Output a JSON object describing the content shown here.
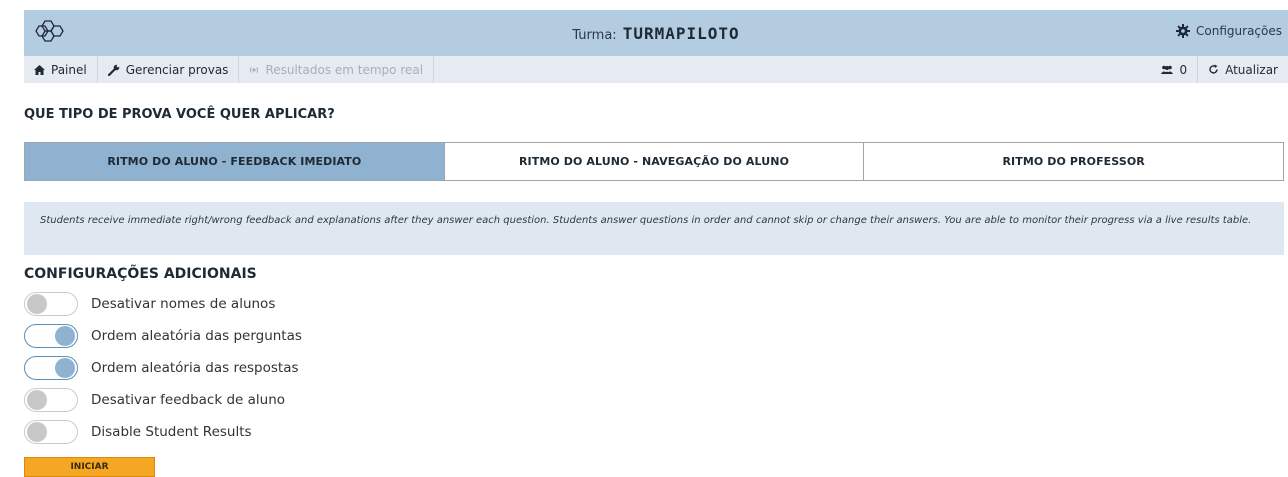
{
  "header": {
    "class_label": "Turma:",
    "class_code": "TURMAPILOTO",
    "settings_label": "Configurações"
  },
  "nav": {
    "items": [
      {
        "label": "Painel",
        "icon": "home-icon"
      },
      {
        "label": "Gerenciar provas",
        "icon": "wrench-icon"
      },
      {
        "label": "Resultados em tempo real",
        "icon": "live-results-icon"
      }
    ],
    "students_count": "0",
    "refresh_label": "Atualizar"
  },
  "quiz_type": {
    "heading": "QUE TIPO DE PROVA VOCÊ QUER APLICAR?",
    "tabs": [
      {
        "label": "RITMO DO ALUNO - FEEDBACK IMEDIATO",
        "active": true
      },
      {
        "label": "RITMO DO ALUNO - NAVEGAÇÃO DO ALUNO",
        "active": false
      },
      {
        "label": "RITMO DO PROFESSOR",
        "active": false
      }
    ],
    "description": "Students receive immediate right/wrong feedback and explanations after they answer each question. Students answer questions in order and cannot skip or change their answers. You are able to monitor their progress via a live results table."
  },
  "additional": {
    "heading": "CONFIGURAÇÕES ADICIONAIS",
    "options": [
      {
        "label": "Desativar nomes de alunos",
        "on": false
      },
      {
        "label": "Ordem aleatória das perguntas",
        "on": true
      },
      {
        "label": "Ordem aleatória das respostas",
        "on": true
      },
      {
        "label": "Desativar feedback de aluno",
        "on": false
      },
      {
        "label": "Disable Student Results",
        "on": false
      }
    ]
  },
  "start_label": "INICIAR",
  "colors": {
    "header_bg": "#b4cce0",
    "nav_bg": "#e6ebf1",
    "active_tab": "#8fb2d0",
    "start_button": "#f5a623"
  }
}
